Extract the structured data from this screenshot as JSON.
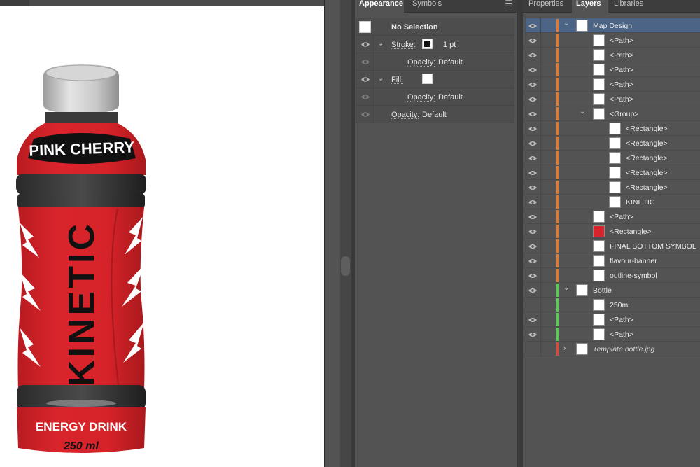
{
  "canvas": {
    "bottle": {
      "flavour": "PINK CHERRY",
      "brand": "KINETIC",
      "subtitle": "ENERGY DRINK",
      "volume": "250 ml"
    },
    "colors": {
      "red": "#d8252b",
      "black": "#121212",
      "cap": "#c8c8c8"
    }
  },
  "appearance_panel": {
    "tabs": [
      {
        "label": "Appearance",
        "active": true
      },
      {
        "label": "Symbols",
        "active": false
      }
    ],
    "menu_icon": "panel-menu-icon",
    "selection_label": "No Selection",
    "rows": [
      {
        "label": "Stroke:",
        "value": "1 pt",
        "swatch": "black"
      },
      {
        "label": "Opacity:",
        "value": "Default"
      },
      {
        "label": "Fill:",
        "swatch": "white"
      },
      {
        "label": "Opacity:",
        "value": "Default"
      },
      {
        "label": "Opacity:",
        "value": "Default"
      }
    ]
  },
  "layers_panel": {
    "tabs": [
      {
        "label": "Properties",
        "active": false
      },
      {
        "label": "Layers",
        "active": true
      },
      {
        "label": "Libraries",
        "active": false
      }
    ],
    "layers": [
      {
        "name": "Map Design",
        "visible": true,
        "selected": true,
        "expanded": true,
        "color": "#e6782c",
        "depth": 0
      },
      {
        "name": "<Path>",
        "visible": true,
        "color": "#e6782c",
        "depth": 1
      },
      {
        "name": "<Path>",
        "visible": true,
        "color": "#e6782c",
        "depth": 1
      },
      {
        "name": "<Path>",
        "visible": true,
        "color": "#e6782c",
        "depth": 1
      },
      {
        "name": "<Path>",
        "visible": true,
        "color": "#e6782c",
        "depth": 1
      },
      {
        "name": "<Path>",
        "visible": true,
        "color": "#e6782c",
        "depth": 1
      },
      {
        "name": "<Group>",
        "visible": true,
        "expanded": true,
        "color": "#e6782c",
        "depth": 1
      },
      {
        "name": "<Rectangle>",
        "visible": true,
        "color": "#e6782c",
        "depth": 2
      },
      {
        "name": "<Rectangle>",
        "visible": true,
        "color": "#e6782c",
        "depth": 2
      },
      {
        "name": "<Rectangle>",
        "visible": true,
        "color": "#e6782c",
        "depth": 2
      },
      {
        "name": "<Rectangle>",
        "visible": true,
        "color": "#e6782c",
        "depth": 2
      },
      {
        "name": "<Rectangle>",
        "visible": true,
        "color": "#e6782c",
        "depth": 2
      },
      {
        "name": "KINETIC",
        "visible": true,
        "color": "#e6782c",
        "depth": 2
      },
      {
        "name": "<Path>",
        "visible": true,
        "color": "#e6782c",
        "depth": 1
      },
      {
        "name": "<Rectangle>",
        "visible": true,
        "color": "#e6782c",
        "depth": 1,
        "thumb": "#d8252b"
      },
      {
        "name": "FINAL BOTTOM SYMBOL",
        "visible": true,
        "color": "#e6782c",
        "depth": 1
      },
      {
        "name": "flavour-banner",
        "visible": true,
        "color": "#e6782c",
        "depth": 1
      },
      {
        "name": "outline-symbol",
        "visible": true,
        "color": "#e6782c",
        "depth": 1
      },
      {
        "name": "Bottle",
        "visible": true,
        "expanded": true,
        "color": "#4fd14f",
        "depth": 0
      },
      {
        "name": "250ml",
        "visible": false,
        "color": "#4fd14f",
        "depth": 1
      },
      {
        "name": "<Path>",
        "visible": true,
        "color": "#4fd14f",
        "depth": 1
      },
      {
        "name": "<Path>",
        "visible": true,
        "color": "#4fd14f",
        "depth": 1
      },
      {
        "name": "Template bottle.jpg",
        "visible": false,
        "expanded": false,
        "color": "#e0463a",
        "depth": 0,
        "template": true
      }
    ]
  }
}
